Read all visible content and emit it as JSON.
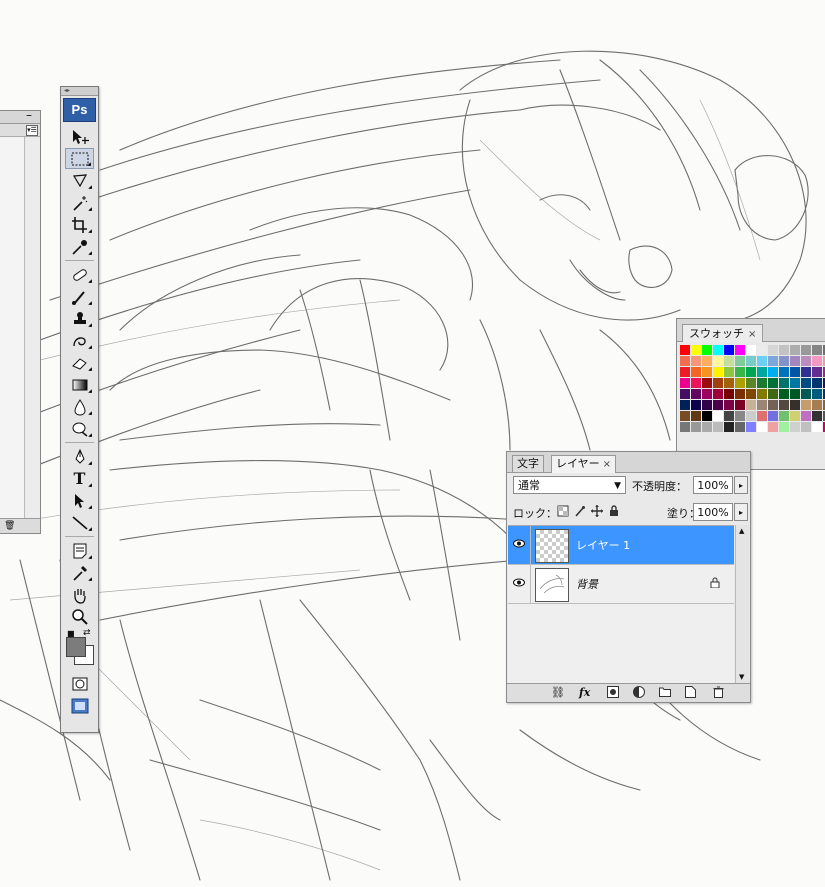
{
  "app": {
    "logo": "Ps"
  },
  "left_panel": {
    "min_glyph": "–",
    "menu_glyph": "▾☰",
    "trash_glyph": "🗑"
  },
  "toolbox": {
    "tools": [
      "move-tool",
      "marquee-tool",
      "lasso-tool",
      "magic-wand-tool",
      "crop-tool",
      "eyedropper-tool",
      "healing-brush-tool",
      "brush-tool",
      "clone-stamp-tool",
      "history-brush-tool",
      "eraser-tool",
      "gradient-tool",
      "blur-tool",
      "dodge-tool",
      "pen-tool",
      "type-tool",
      "path-selection-tool",
      "line-tool",
      "notes-tool",
      "eyedropper-2-tool",
      "hand-tool",
      "zoom-tool"
    ],
    "type_glyph": "T",
    "foreground_color": "#7c7c7c",
    "background_color": "#ffffff"
  },
  "swatches": {
    "tab_label": "スウォッチ",
    "close_glyph": "×",
    "colors": [
      "#ff0000",
      "#ffff00",
      "#00ff00",
      "#00ffff",
      "#0000ff",
      "#ff00ff",
      "#ffffff",
      "#ebebeb",
      "#d6d6d6",
      "#c2c2c2",
      "#adadad",
      "#999999",
      "#858585",
      "#707070",
      "#f26c4f",
      "#f69679",
      "#fbaf5d",
      "#fff79a",
      "#c4df9b",
      "#82ca9c",
      "#7accc8",
      "#6dcff6",
      "#7da7d9",
      "#8393ca",
      "#a187be",
      "#bc8cbf",
      "#f49ac2",
      "#f6989d",
      "#ed1c24",
      "#f26522",
      "#f7941d",
      "#fff200",
      "#8dc63f",
      "#39b54a",
      "#00a651",
      "#00a99d",
      "#00aeef",
      "#0072bc",
      "#0054a6",
      "#2e3192",
      "#662d91",
      "#92278f",
      "#ec008c",
      "#ed145b",
      "#9e0b0f",
      "#a0410d",
      "#a36209",
      "#aba000",
      "#598527",
      "#1a7b30",
      "#007236",
      "#00746b",
      "#0076a3",
      "#004b80",
      "#003471",
      "#1b1464",
      "#440e62",
      "#630460",
      "#9e005d",
      "#9e0039",
      "#790000",
      "#7b2e00",
      "#7d4900",
      "#827b00",
      "#406618",
      "#005e20",
      "#005826",
      "#005952",
      "#005b7f",
      "#003663",
      "#002157",
      "#0d004c",
      "#32004b",
      "#4b0049",
      "#7b0046",
      "#7a0026",
      "#c7b299",
      "#998675",
      "#736357",
      "#534741",
      "#37302a",
      "#c69c6d",
      "#a67c52",
      "#8c6239",
      "#754c24",
      "#603913",
      "#000000",
      "#ffffff",
      "#444444",
      "#888888",
      "#cccccc",
      "#e07070",
      "#7070e0",
      "#70c070",
      "#d0d070",
      "#c070c0",
      "#333333",
      "#555555",
      "#777777",
      "#999999",
      "#aaaaaa",
      "#bbbbbb",
      "#222222",
      "#666666",
      "#8080ff",
      "#ffffff",
      "#f0a0a0",
      "#a0f0a0",
      "#d0d0d0",
      "#c0c0c0",
      "#ffffff",
      "#cc0066"
    ]
  },
  "layers": {
    "tab_text": "文字",
    "tab_layers": "レイヤー",
    "close_glyph": "×",
    "blend_mode": "通常",
    "dropdown_arrow": "▼",
    "opacity_label": "不透明度：",
    "opacity_value": "100%",
    "lock_label": "ロック：",
    "fill_label": "塗り：",
    "fill_value": "100%",
    "stepper_glyph": "▸",
    "items": [
      {
        "name": "レイヤー 1",
        "visible": true,
        "selected": true,
        "locked": false
      },
      {
        "name": "背景",
        "visible": true,
        "selected": false,
        "locked": true
      }
    ],
    "footer_icons": [
      "link-layers-icon",
      "fx-icon",
      "layer-mask-icon",
      "adjustment-layer-icon",
      "new-group-icon",
      "new-layer-icon",
      "delete-layer-icon"
    ],
    "footer_labels": {
      "fx": "fx"
    }
  }
}
